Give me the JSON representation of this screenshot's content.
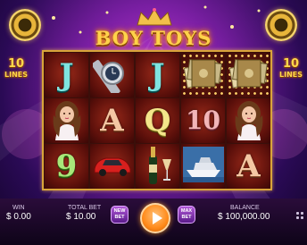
{
  "game": {
    "logo": "BOY TOYS",
    "lines_left": {
      "number": "10",
      "word": "LINES"
    },
    "lines_right": {
      "number": "10",
      "word": "LINES"
    }
  },
  "reels": {
    "columns": [
      [
        {
          "type": "letter",
          "text": "J",
          "style": "teal",
          "bg": "red"
        },
        {
          "type": "girl",
          "bg": "red"
        },
        {
          "type": "letter",
          "text": "9",
          "style": "green",
          "bg": "red"
        }
      ],
      [
        {
          "type": "watch",
          "bg": "red"
        },
        {
          "type": "letter",
          "text": "A",
          "style": "peach",
          "bg": "red"
        },
        {
          "type": "car",
          "bg": "red"
        }
      ],
      [
        {
          "type": "letter",
          "text": "J",
          "style": "teal",
          "bg": "red"
        },
        {
          "type": "letter",
          "text": "Q",
          "style": "yellow",
          "bg": "red"
        },
        {
          "type": "champagne",
          "bg": "red"
        }
      ],
      [
        {
          "type": "cash",
          "bg": "dots"
        },
        {
          "type": "letter",
          "text": "10",
          "style": "pink",
          "bg": "red"
        },
        {
          "type": "yacht",
          "bg": "red"
        }
      ],
      [
        {
          "type": "cash",
          "bg": "dots"
        },
        {
          "type": "girl",
          "bg": "red"
        },
        {
          "type": "letter",
          "text": "A",
          "style": "peach",
          "bg": "red"
        }
      ]
    ]
  },
  "hud": {
    "win_label": "WIN",
    "win_value": "$ 0.00",
    "total_bet_label": "TOTAL BET",
    "total_bet_value": "$ 10.00",
    "new_bet_line1": "NEW",
    "new_bet_line2": "BET",
    "max_bet_line1": "MAX",
    "max_bet_line2": "BET",
    "balance_label": "BALANCE",
    "balance_value": "$ 100,000.00"
  },
  "icons": {
    "speaker_left": "speaker-icon",
    "speaker_right": "speaker-icon",
    "spin": "play-icon",
    "menu": "grid-menu-icon"
  },
  "colors": {
    "frame_gold": "#d9a43a",
    "spin_orange": "#ff8a1a",
    "bg_purple": "#7a1fa3"
  }
}
